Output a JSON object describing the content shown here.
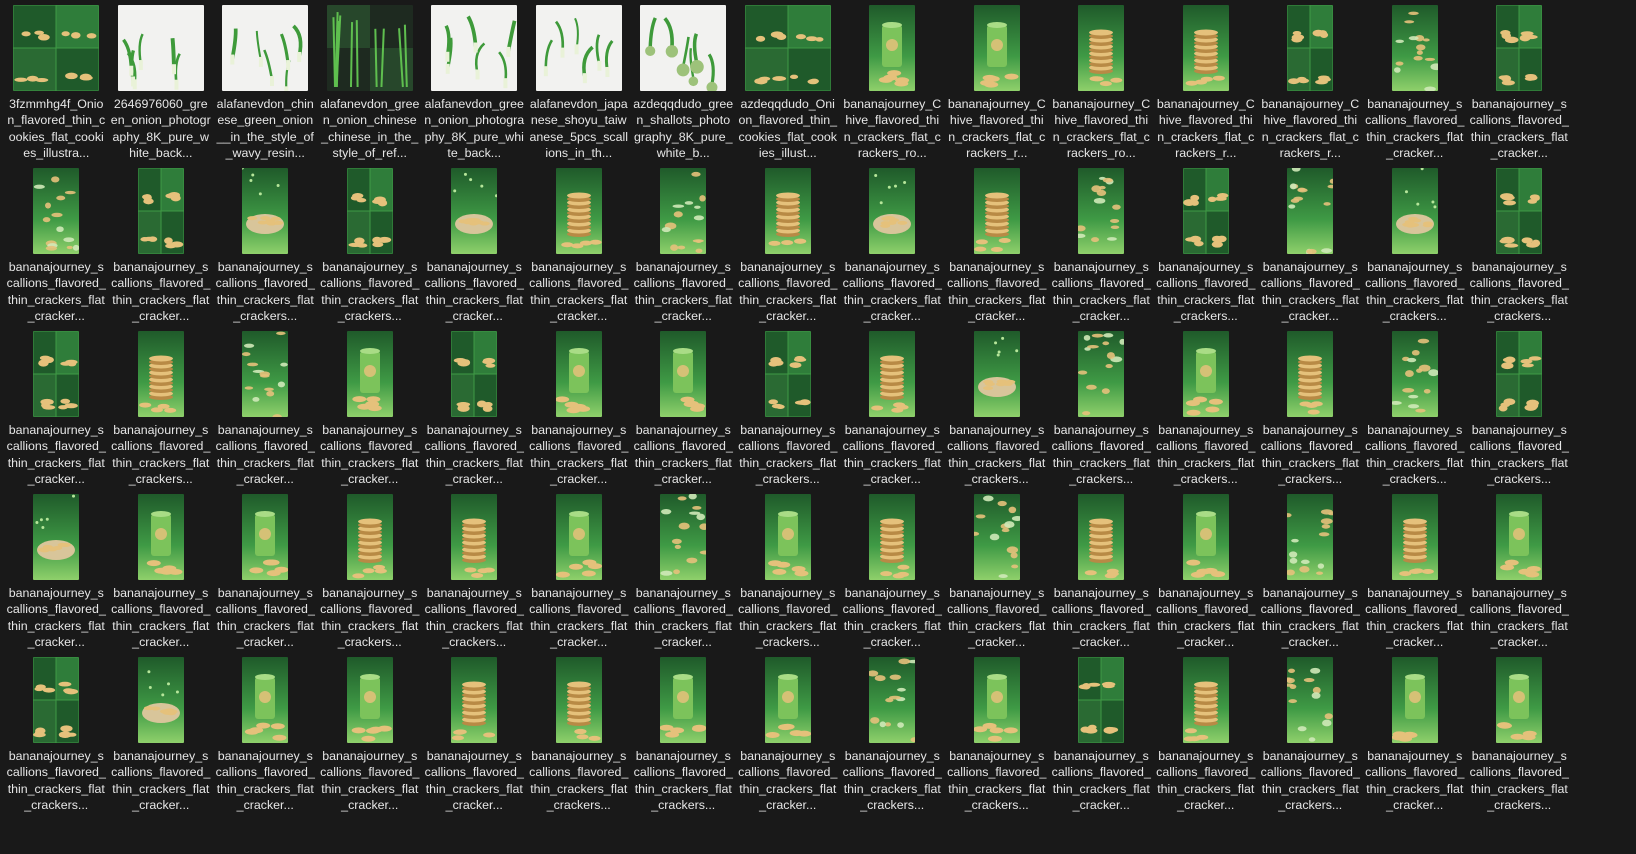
{
  "thumbnail_kinds": {
    "grid4_green": "four-panel green snack collage",
    "white_scallion": "green onion on white background",
    "dark_scallion": "green onions on dark background",
    "white_shallot": "shallots on white background",
    "tall_can": "snack can with crackers",
    "tall_stack": "stack of thin crackers",
    "tall_scatter": "scattered cracker chips",
    "tall_bowl": "bowl of crackers",
    "tall_grid4": "four-panel vertical collage"
  },
  "items": [
    {
      "name": "3fzmmhg4f_Onion_flavored_thin_cookies_flat_cookies_illustra...",
      "kind": "grid4_green",
      "shape": "square"
    },
    {
      "name": "2646976060_green_onion_photography_8K_pure_white_back...",
      "kind": "white_scallion",
      "shape": "square"
    },
    {
      "name": "alafanevdon_chinese_green_onion__in_the_style_of_wavy_resin...",
      "kind": "white_scallion",
      "shape": "square"
    },
    {
      "name": "alafanevdon_green_onion_chinese_chinese_in_the_style_of_ref...",
      "kind": "dark_scallion",
      "shape": "square"
    },
    {
      "name": "alafanevdon_green_onion_photography_8K_pure_white_back...",
      "kind": "white_scallion",
      "shape": "square"
    },
    {
      "name": "alafanevdon_japanese_shoyu_taiwanese_5pcs_scallions_in_th...",
      "kind": "white_scallion",
      "shape": "square"
    },
    {
      "name": "azdeqqdudo_green_shallots_photography_8K_pure_white_b...",
      "kind": "white_shallot",
      "shape": "square"
    },
    {
      "name": "azdeqqdudo_Onion_flavored_thin_cookies_flat_cookies_illust...",
      "kind": "grid4_green",
      "shape": "square"
    },
    {
      "name": "bananajourney_Chive_flavored_thin_crackers_flat_crackers_ro...",
      "kind": "tall_can",
      "shape": "tall"
    },
    {
      "name": "bananajourney_Chive_flavored_thin_crackers_flat_crackers_r...",
      "kind": "tall_can",
      "shape": "tall"
    },
    {
      "name": "bananajourney_Chive_flavored_thin_crackers_flat_crackers_ro...",
      "kind": "tall_stack",
      "shape": "tall"
    },
    {
      "name": "bananajourney_Chive_flavored_thin_crackers_flat_crackers_r...",
      "kind": "tall_stack",
      "shape": "tall"
    },
    {
      "name": "bananajourney_Chive_flavored_thin_crackers_flat_crackers_r...",
      "kind": "tall_grid4",
      "shape": "tall"
    },
    {
      "name": "bananajourney_scallions_flavored_thin_crackers_flat_cracker...",
      "kind": "tall_scatter",
      "shape": "tall"
    },
    {
      "name": "bananajourney_scallions_flavored_thin_crackers_flat_cracker...",
      "kind": "tall_grid4",
      "shape": "tall"
    },
    {
      "name": "bananajourney_scallions_flavored_thin_crackers_flat_cracker...",
      "kind": "tall_scatter",
      "shape": "tall"
    },
    {
      "name": "bananajourney_scallions_flavored_thin_crackers_flat_cracker...",
      "kind": "tall_grid4",
      "shape": "tall"
    },
    {
      "name": "bananajourney_scallions_flavored_thin_crackers_flat_crackers...",
      "kind": "tall_bowl",
      "shape": "tall"
    },
    {
      "name": "bananajourney_scallions_flavored_thin_crackers_flat_crackers...",
      "kind": "tall_grid4",
      "shape": "tall"
    },
    {
      "name": "bananajourney_scallions_flavored_thin_crackers_flat_cracker...",
      "kind": "tall_bowl",
      "shape": "tall"
    },
    {
      "name": "bananajourney_scallions_flavored_thin_crackers_flat_cracker...",
      "kind": "tall_stack",
      "shape": "tall"
    },
    {
      "name": "bananajourney_scallions_flavored_thin_crackers_flat_cracker...",
      "kind": "tall_scatter",
      "shape": "tall"
    },
    {
      "name": "bananajourney_scallions_flavored_thin_crackers_flat_cracker...",
      "kind": "tall_stack",
      "shape": "tall"
    },
    {
      "name": "bananajourney_scallions_flavored_thin_crackers_flat_cracker...",
      "kind": "tall_bowl",
      "shape": "tall"
    },
    {
      "name": "bananajourney_scallions_flavored_thin_crackers_flat_cracker...",
      "kind": "tall_stack",
      "shape": "tall"
    },
    {
      "name": "bananajourney_scallions_flavored_thin_crackers_flat_cracker...",
      "kind": "tall_scatter",
      "shape": "tall"
    },
    {
      "name": "bananajourney_scallions_flavored_thin_crackers_flat_crackers...",
      "kind": "tall_grid4",
      "shape": "tall"
    },
    {
      "name": "bananajourney_scallions_flavored_thin_crackers_flat_cracker...",
      "kind": "tall_scatter",
      "shape": "tall"
    },
    {
      "name": "bananajourney_scallions_flavored_thin_crackers_flat_crackers...",
      "kind": "tall_bowl",
      "shape": "tall"
    },
    {
      "name": "bananajourney_scallions_flavored_thin_crackers_flat_crackers...",
      "kind": "tall_grid4",
      "shape": "tall"
    },
    {
      "name": "bananajourney_scallions_flavored_thin_crackers_flat_cracker...",
      "kind": "tall_grid4",
      "shape": "tall"
    },
    {
      "name": "bananajourney_scallions_flavored_thin_crackers_flat_crackers...",
      "kind": "tall_stack",
      "shape": "tall"
    },
    {
      "name": "bananajourney_scallions_flavored_thin_crackers_flat_cracker...",
      "kind": "tall_scatter",
      "shape": "tall"
    },
    {
      "name": "bananajourney_scallions_flavored_thin_crackers_flat_cracker...",
      "kind": "tall_can",
      "shape": "tall"
    },
    {
      "name": "bananajourney_scallions_flavored_thin_crackers_flat_cracker...",
      "kind": "tall_grid4",
      "shape": "tall"
    },
    {
      "name": "bananajourney_scallions_flavored_thin_crackers_flat_cracker...",
      "kind": "tall_can",
      "shape": "tall"
    },
    {
      "name": "bananajourney_scallions_flavored_thin_crackers_flat_cracker...",
      "kind": "tall_can",
      "shape": "tall"
    },
    {
      "name": "bananajourney_scallions_flavored_thin_crackers_flat_crackers...",
      "kind": "tall_grid4",
      "shape": "tall"
    },
    {
      "name": "bananajourney_scallions_flavored_thin_crackers_flat_cracker...",
      "kind": "tall_stack",
      "shape": "tall"
    },
    {
      "name": "bananajourney_scallions_flavored_thin_crackers_flat_crackers...",
      "kind": "tall_bowl",
      "shape": "tall"
    },
    {
      "name": "bananajourney_scallions_flavored_thin_crackers_flat_crackers...",
      "kind": "tall_scatter",
      "shape": "tall"
    },
    {
      "name": "bananajourney_scallions_flavored_thin_crackers_flat_crackers...",
      "kind": "tall_can",
      "shape": "tall"
    },
    {
      "name": "bananajourney_scallions_flavored_thin_crackers_flat_crackers...",
      "kind": "tall_stack",
      "shape": "tall"
    },
    {
      "name": "bananajourney_scallions_flavored_thin_crackers_flat_crackers...",
      "kind": "tall_scatter",
      "shape": "tall"
    },
    {
      "name": "bananajourney_scallions_flavored_thin_crackers_flat_crackers...",
      "kind": "tall_grid4",
      "shape": "tall"
    },
    {
      "name": "bananajourney_scallions_flavored_thin_crackers_flat_cracker...",
      "kind": "tall_bowl",
      "shape": "tall"
    },
    {
      "name": "bananajourney_scallions_flavored_thin_crackers_flat_cracker...",
      "kind": "tall_can",
      "shape": "tall"
    },
    {
      "name": "bananajourney_scallions_flavored_thin_crackers_flat_cracker...",
      "kind": "tall_can",
      "shape": "tall"
    },
    {
      "name": "bananajourney_scallions_flavored_thin_crackers_flat_crackers...",
      "kind": "tall_stack",
      "shape": "tall"
    },
    {
      "name": "bananajourney_scallions_flavored_thin_crackers_flat_crackers...",
      "kind": "tall_stack",
      "shape": "tall"
    },
    {
      "name": "bananajourney_scallions_flavored_thin_crackers_flat_cracker...",
      "kind": "tall_can",
      "shape": "tall"
    },
    {
      "name": "bananajourney_scallions_flavored_thin_crackers_flat_cracker...",
      "kind": "tall_scatter",
      "shape": "tall"
    },
    {
      "name": "bananajourney_scallions_flavored_thin_crackers_flat_crackers...",
      "kind": "tall_can",
      "shape": "tall"
    },
    {
      "name": "bananajourney_scallions_flavored_thin_crackers_flat_cracker...",
      "kind": "tall_stack",
      "shape": "tall"
    },
    {
      "name": "bananajourney_scallions_flavored_thin_crackers_flat_cracker...",
      "kind": "tall_scatter",
      "shape": "tall"
    },
    {
      "name": "bananajourney_scallions_flavored_thin_crackers_flat_cracker...",
      "kind": "tall_stack",
      "shape": "tall"
    },
    {
      "name": "bananajourney_scallions_flavored_thin_crackers_flat_cracker...",
      "kind": "tall_can",
      "shape": "tall"
    },
    {
      "name": "bananajourney_scallions_flavored_thin_crackers_flat_cracker...",
      "kind": "tall_scatter",
      "shape": "tall"
    },
    {
      "name": "bananajourney_scallions_flavored_thin_crackers_flat_cracker...",
      "kind": "tall_stack",
      "shape": "tall"
    },
    {
      "name": "bananajourney_scallions_flavored_thin_crackers_flat_cracker...",
      "kind": "tall_can",
      "shape": "tall"
    },
    {
      "name": "bananajourney_scallions_flavored_thin_crackers_flat_crackers...",
      "kind": "tall_grid4",
      "shape": "tall"
    },
    {
      "name": "bananajourney_scallions_flavored_thin_crackers_flat_cracker...",
      "kind": "tall_bowl",
      "shape": "tall"
    },
    {
      "name": "bananajourney_scallions_flavored_thin_crackers_flat_cracker...",
      "kind": "tall_can",
      "shape": "tall"
    },
    {
      "name": "bananajourney_scallions_flavored_thin_crackers_flat_cracker...",
      "kind": "tall_can",
      "shape": "tall"
    },
    {
      "name": "bananajourney_scallions_flavored_thin_crackers_flat_cracker...",
      "kind": "tall_stack",
      "shape": "tall"
    },
    {
      "name": "bananajourney_scallions_flavored_thin_crackers_flat_crackers...",
      "kind": "tall_stack",
      "shape": "tall"
    },
    {
      "name": "bananajourney_scallions_flavored_thin_crackers_flat_crackers...",
      "kind": "tall_can",
      "shape": "tall"
    },
    {
      "name": "bananajourney_scallions_flavored_thin_crackers_flat_cracker...",
      "kind": "tall_can",
      "shape": "tall"
    },
    {
      "name": "bananajourney_scallions_flavored_thin_crackers_flat_crackers...",
      "kind": "tall_scatter",
      "shape": "tall"
    },
    {
      "name": "bananajourney_scallions_flavored_thin_crackers_flat_crackers...",
      "kind": "tall_can",
      "shape": "tall"
    },
    {
      "name": "bananajourney_scallions_flavored_thin_crackers_flat_cracker...",
      "kind": "tall_grid4",
      "shape": "tall"
    },
    {
      "name": "bananajourney_scallions_flavored_thin_crackers_flat_cracker...",
      "kind": "tall_stack",
      "shape": "tall"
    },
    {
      "name": "bananajourney_scallions_flavored_thin_crackers_flat_crackers...",
      "kind": "tall_scatter",
      "shape": "tall"
    },
    {
      "name": "bananajourney_scallions_flavored_thin_crackers_flat_cracker...",
      "kind": "tall_can",
      "shape": "tall"
    },
    {
      "name": "bananajourney_scallions_flavored_thin_crackers_flat_crackers...",
      "kind": "tall_can",
      "shape": "tall"
    }
  ],
  "colors": {
    "background": "#191919",
    "label_text": "#e6e6e6",
    "green_dark": "#1f5a2a",
    "green_mid": "#3f9a45",
    "green_light": "#8fd06b",
    "cracker": "#e5c17b",
    "cracker_dark": "#b88a45"
  }
}
